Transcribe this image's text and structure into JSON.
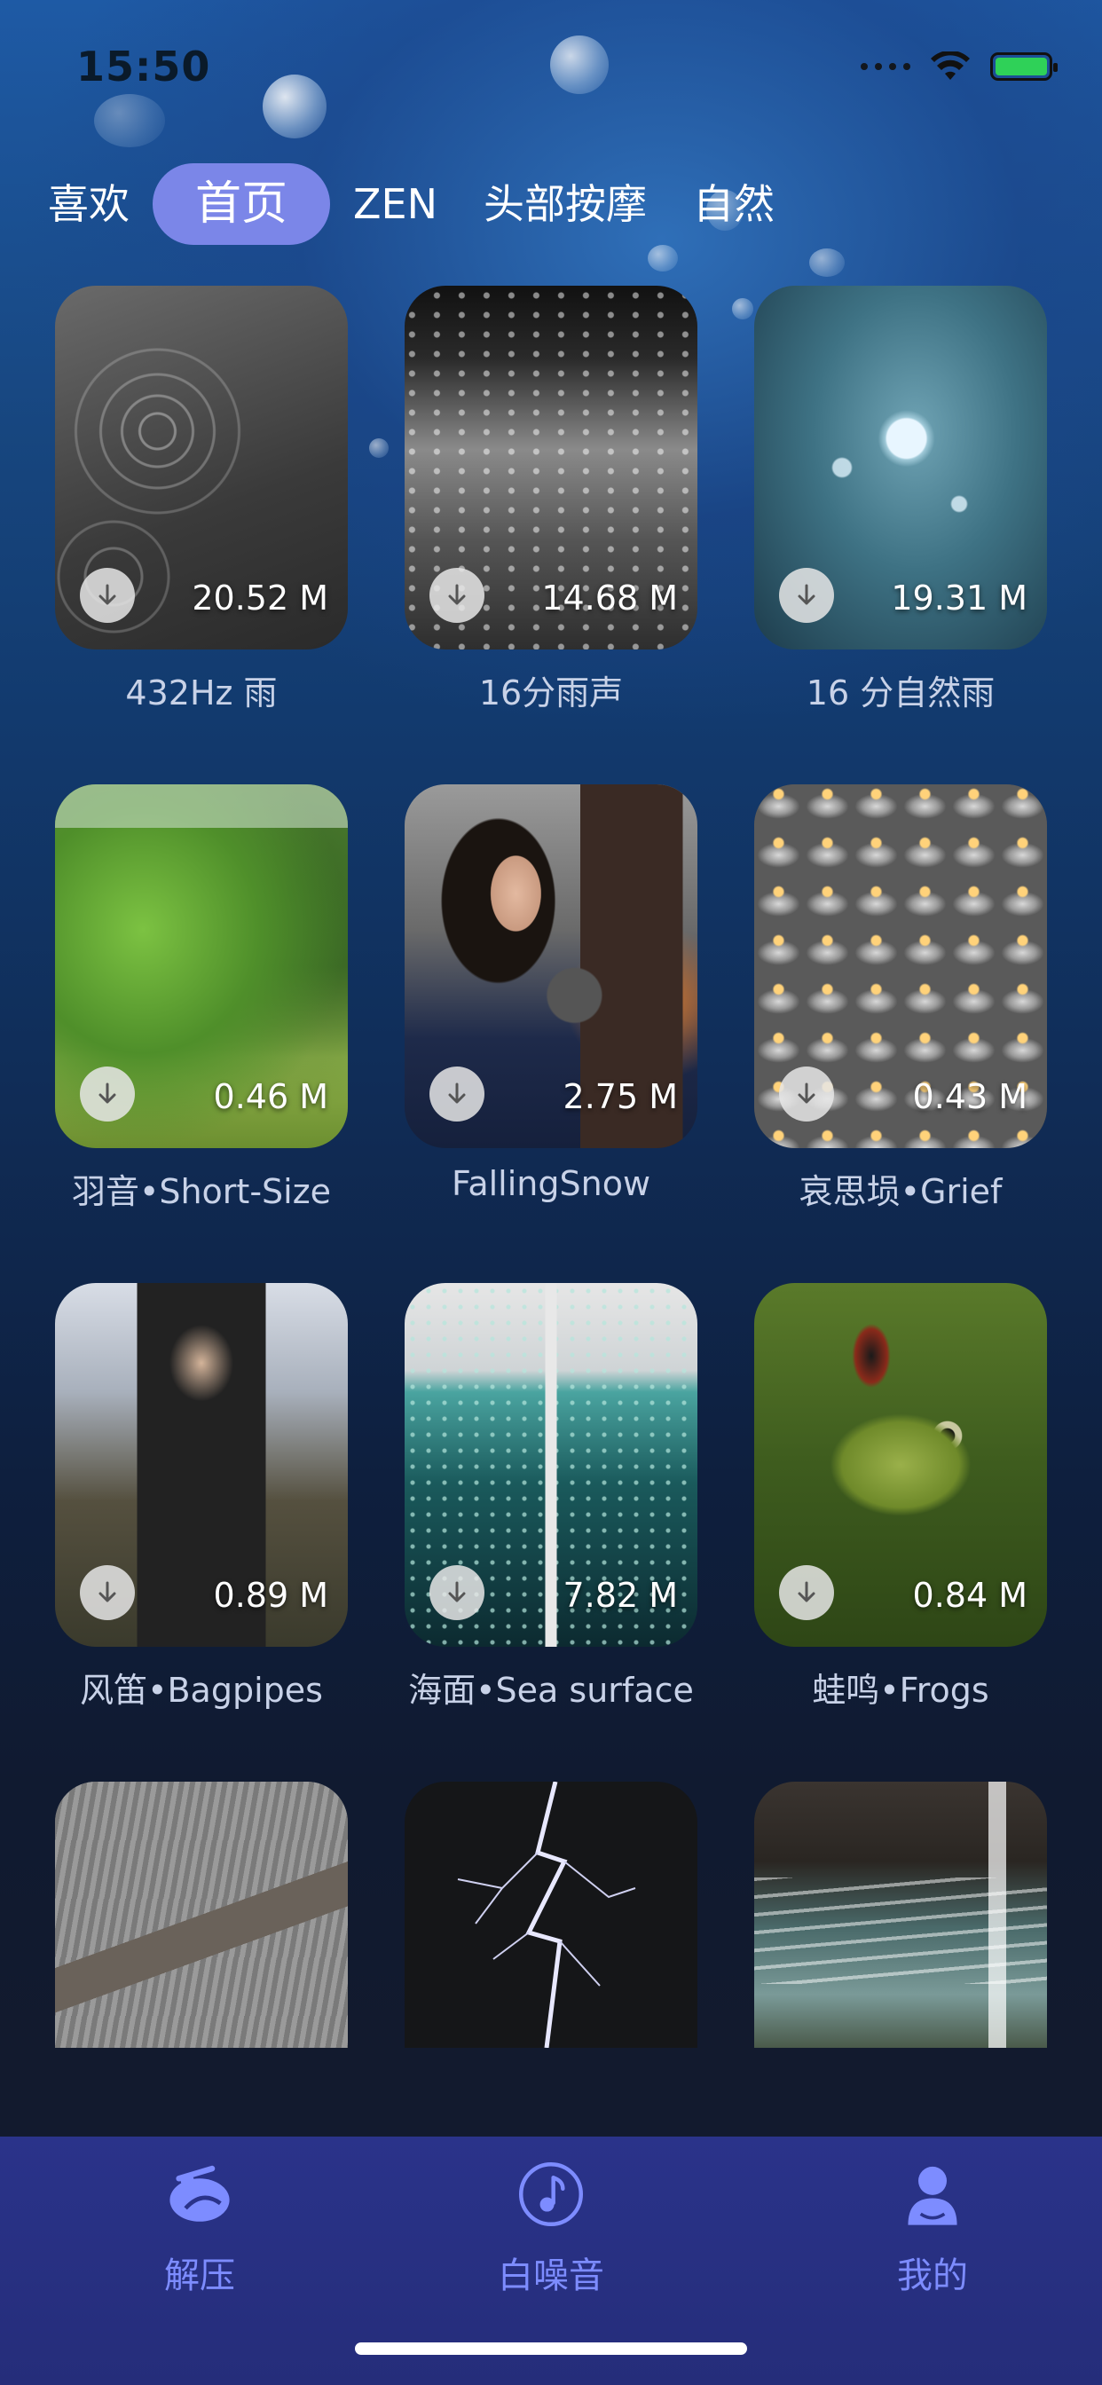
{
  "status_bar": {
    "time": "15:50"
  },
  "tabs": [
    {
      "label": "喜欢",
      "active": false
    },
    {
      "label": "首页",
      "active": true
    },
    {
      "label": "ZEN",
      "active": false
    },
    {
      "label": "头部按摩",
      "active": false
    },
    {
      "label": "自然",
      "active": false
    }
  ],
  "cards": [
    {
      "title": "432Hz 雨",
      "size": "20.52 M"
    },
    {
      "title": "16分雨声",
      "size": "14.68 M"
    },
    {
      "title": "16 分自然雨",
      "size": "19.31 M"
    },
    {
      "title": "羽音•Short-Size",
      "size": "0.46 M"
    },
    {
      "title": "FallingSnow",
      "size": "2.75 M"
    },
    {
      "title": "哀思埙•Grief",
      "size": "0.43 M"
    },
    {
      "title": "风笛•Bagpipes",
      "size": "0.89 M"
    },
    {
      "title": "海面•Sea surface",
      "size": "7.82 M"
    },
    {
      "title": "蛙鸣•Frogs",
      "size": "0.84 M"
    }
  ],
  "tabbar": [
    {
      "label": "解压",
      "icon": "bird-icon"
    },
    {
      "label": "白噪音",
      "icon": "music-note-icon"
    },
    {
      "label": "我的",
      "icon": "user-icon"
    }
  ],
  "colors": {
    "accent": "#7b86e8",
    "tabbar_bg": "#2a338a",
    "tabbar_icon": "#7d8cff"
  }
}
